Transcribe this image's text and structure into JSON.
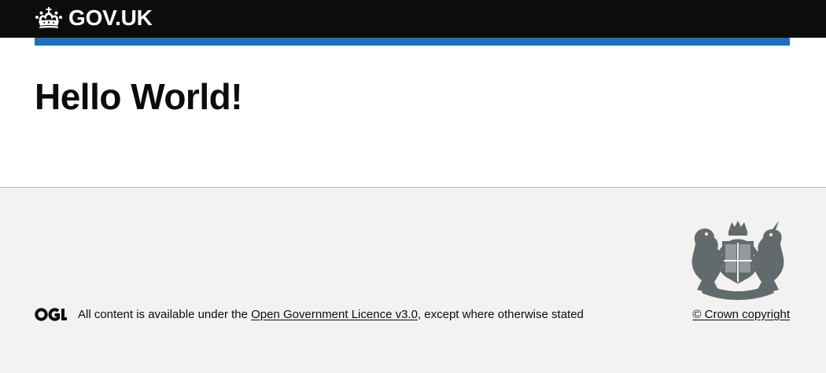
{
  "header": {
    "logotype": "GOV.UK"
  },
  "main": {
    "title": "Hello World!"
  },
  "footer": {
    "licence_prefix": "All content is available under the ",
    "licence_link": "Open Government Licence v3.0",
    "licence_suffix": ", except where otherwise stated",
    "copyright": "© Crown copyright"
  },
  "icons": [
    "crown-icon",
    "ogl-logo-icon",
    "royal-coat-of-arms-icon"
  ],
  "colors": {
    "header_bg": "#0b0c0c",
    "accent_blue": "#1d70b8",
    "footer_bg": "#f3f2f1",
    "footer_border": "#b1b4b6",
    "text": "#0b0c0c"
  }
}
